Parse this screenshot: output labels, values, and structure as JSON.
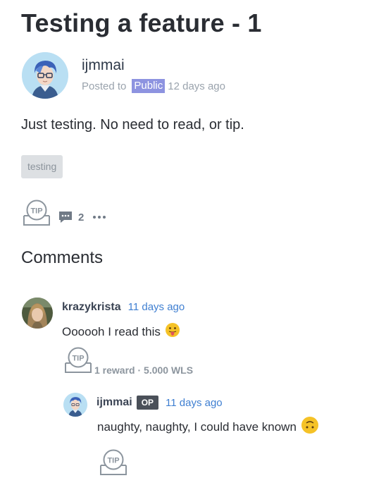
{
  "post": {
    "title": "Testing a feature - 1",
    "author": "ijmmai",
    "posted_to_label": "Posted to",
    "community": "Public",
    "time_ago": "12 days ago",
    "body": "Just testing. No need to read, or tip.",
    "tags": [
      "testing"
    ],
    "tip_label": "TIP",
    "comment_count": "2",
    "more_icon": "ellipsis-icon"
  },
  "comments": {
    "section_title": "Comments",
    "items": [
      {
        "author": "krazykrista",
        "time_ago": "11 days ago",
        "text": "Oooooh I read this",
        "emoji": "tongue-out-emoji",
        "tip_label": "TIP",
        "reward_text": "1 reward · 5.000 WLS"
      },
      {
        "author": "ijmmai",
        "op_badge": "OP",
        "time_ago": "11 days ago",
        "text": "naughty, naughty, I could have known",
        "emoji": "upside-down-face-emoji",
        "tip_label": "TIP"
      }
    ]
  },
  "colors": {
    "public_badge": "#8d93e0",
    "timestamp_link": "#3f7fd1",
    "op_badge": "#4a5059",
    "tag_bg": "#dde0e3",
    "icon_gray": "#8c959e"
  }
}
